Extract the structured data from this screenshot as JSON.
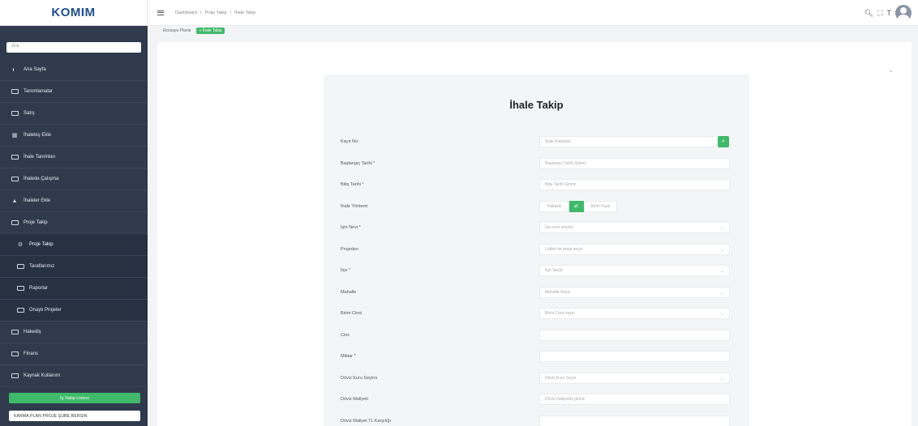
{
  "app": {
    "logo": "KOMIM"
  },
  "sidebar": {
    "search_placeholder": "Ara",
    "items": [
      {
        "label": "Ana Sayfa",
        "icon": "dot-icon",
        "kind": "top"
      },
      {
        "label": "Tanımlamalar",
        "icon": "folder-icon",
        "kind": "top"
      },
      {
        "label": "Satış",
        "icon": "folder-icon",
        "kind": "top"
      },
      {
        "label": "İhaleleş Ekle",
        "icon": "grid-icon",
        "kind": "top"
      },
      {
        "label": "İhale Tanımları",
        "icon": "folder-icon",
        "kind": "top"
      },
      {
        "label": "İhalede Çalışma",
        "icon": "folder-icon",
        "kind": "top"
      },
      {
        "label": "İhaleler Ekle",
        "icon": "upload-icon",
        "kind": "top"
      },
      {
        "label": "Proje Takip",
        "icon": "folder-icon",
        "kind": "top"
      },
      {
        "label": "Proje Takip",
        "icon": "gear-icon",
        "kind": "sub-active"
      },
      {
        "label": "Taraflarımız",
        "icon": "folder-icon",
        "kind": "sub"
      },
      {
        "label": "Raporlar",
        "icon": "folder-icon",
        "kind": "sub"
      },
      {
        "label": "Onaylı Projeler",
        "icon": "folder-icon",
        "kind": "sub"
      },
      {
        "label": "Hakediş",
        "icon": "folder-icon",
        "kind": "top"
      },
      {
        "label": "Finans",
        "icon": "folder-icon",
        "kind": "top"
      },
      {
        "label": "Kaynak Kullanım",
        "icon": "folder-icon",
        "kind": "top"
      }
    ],
    "green_button": "İş Takip Listesi",
    "plan_label": "KARMA PLAN PROJE ŞUBE BERSIN"
  },
  "topbar": {
    "breadcrumbs": [
      "Dashboard",
      "Proje Takip",
      "İhale Takip"
    ]
  },
  "subtabs": [
    {
      "label": "Ekosaya Planla",
      "active": false
    },
    {
      "label": "+ İhale Takip",
      "active": true
    }
  ],
  "form": {
    "title": "İhale Takip",
    "rows": [
      {
        "label": "Kayıt No:",
        "placeholder": "İhale Kodunuz",
        "type": "search"
      },
      {
        "label": "Başlangıç Tarihi *",
        "placeholder": "Başlangıç Tarihi Giriniz",
        "type": "text"
      },
      {
        "label": "Bitiş Tarihi *",
        "placeholder": "Bitiş Tarihi Giriniz",
        "type": "text"
      },
      {
        "label": "İhale Yöntemi",
        "placeholder": "",
        "type": "radio"
      },
      {
        "label": "İşin Nevi *",
        "placeholder": "İşin nevi seçiniz",
        "type": "select"
      },
      {
        "label": "Projeden",
        "placeholder": "Lütfen bir proje seçin",
        "type": "select"
      },
      {
        "label": "İlçe *",
        "placeholder": "İlçe Seçin",
        "type": "select"
      },
      {
        "label": "Mahalle",
        "placeholder": "Mahalle Seçin",
        "type": "select"
      },
      {
        "label": "Birim Cinsi",
        "placeholder": "Birim Cinsi seçin",
        "type": "select"
      },
      {
        "label": "Cins",
        "placeholder": "",
        "type": "text"
      },
      {
        "label": "Miktar *",
        "placeholder": "",
        "type": "text"
      },
      {
        "label": "Döviz Kuru Seçimi",
        "placeholder": "Döviz Kuru Seçin",
        "type": "select"
      },
      {
        "label": "Döviz Maliyeti",
        "placeholder": "Döviz maliyetini giriniz",
        "type": "text"
      },
      {
        "label": "Döviz Maliyet TL Karşılığı",
        "placeholder": "",
        "type": "text"
      }
    ],
    "radio_options": [
      "Yaklaşık",
      "Birim Fiyat"
    ]
  },
  "colors": {
    "sidebar": "#2f3b4c",
    "accent": "#3fb96a"
  }
}
